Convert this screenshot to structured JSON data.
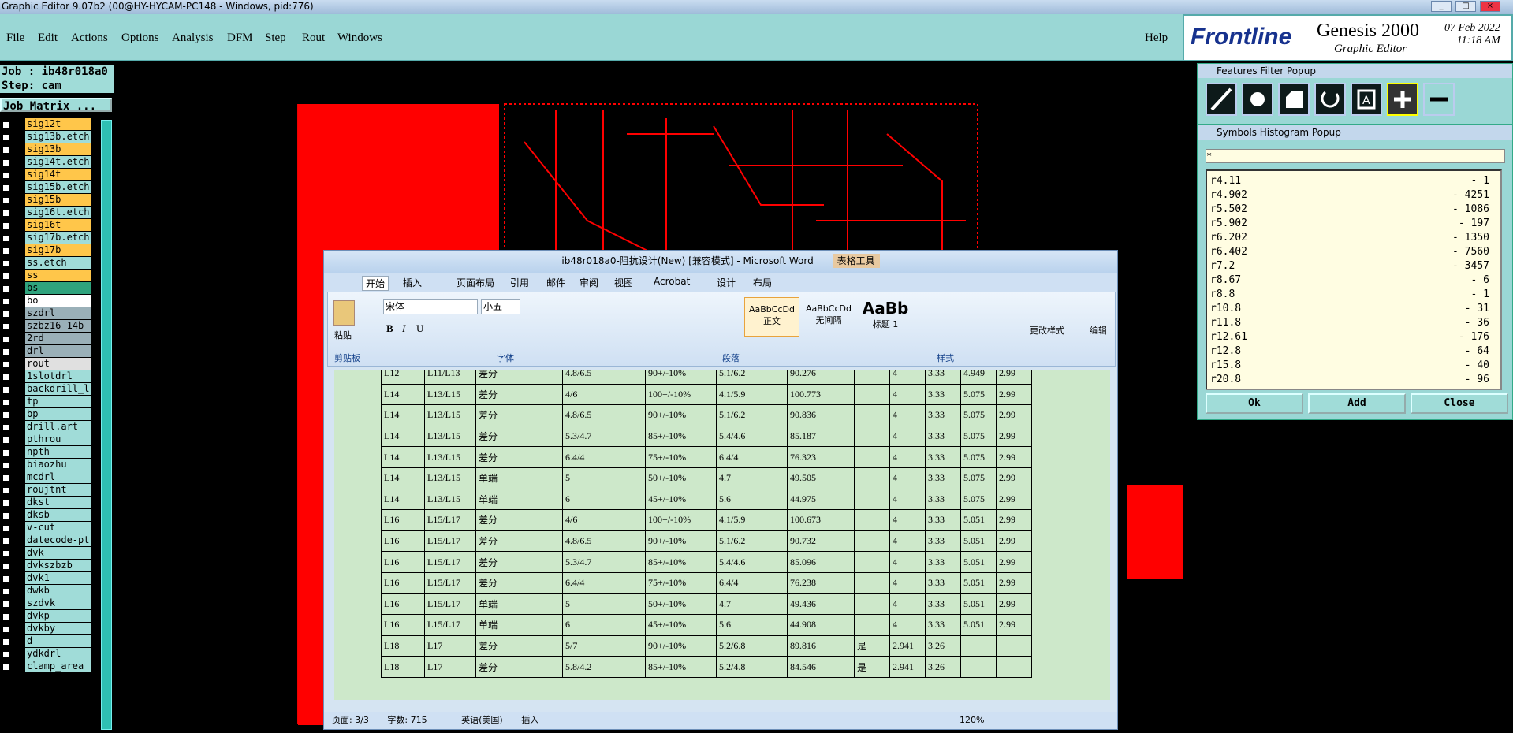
{
  "app": {
    "title": "Graphic Editor 9.07b2 (00@HY-HYCAM-PC148 - Windows, pid:776)"
  },
  "menu": [
    "File",
    "Edit",
    "Actions",
    "Options",
    "Analysis",
    "DFM",
    "Step",
    "Rout",
    "Windows"
  ],
  "help": "Help",
  "logo": {
    "brand": "Frontline",
    "product": "Genesis 2000",
    "sub": "Graphic Editor",
    "date": "07 Feb 2022",
    "time": "11:18 AM"
  },
  "job": {
    "job": "Job : ib48r018a0",
    "step": "Step: cam",
    "matrix": "Job Matrix ..."
  },
  "layers": [
    {
      "name": "sig12t",
      "color": "#ffc64a"
    },
    {
      "name": "sig13b.etch",
      "color": "#a0dcd8"
    },
    {
      "name": "sig13b",
      "color": "#ffc64a"
    },
    {
      "name": "sig14t.etch",
      "color": "#a0dcd8"
    },
    {
      "name": "sig14t",
      "color": "#ffc64a"
    },
    {
      "name": "sig15b.etch",
      "color": "#a0dcd8"
    },
    {
      "name": "sig15b",
      "color": "#ffc64a"
    },
    {
      "name": "sig16t.etch",
      "color": "#a0dcd8"
    },
    {
      "name": "sig16t",
      "color": "#ffc64a"
    },
    {
      "name": "sig17b.etch",
      "color": "#a0dcd8"
    },
    {
      "name": "sig17b",
      "color": "#ffc64a"
    },
    {
      "name": "ss.etch",
      "color": "#a0dcd8"
    },
    {
      "name": "ss",
      "color": "#ffc64a"
    },
    {
      "name": "bs",
      "color": "#2fa37d"
    },
    {
      "name": "bo",
      "color": "#ffffff"
    },
    {
      "name": "szdrl",
      "color": "#9ab0b8"
    },
    {
      "name": "szbz16-14b",
      "color": "#9ab0b8"
    },
    {
      "name": "2rd",
      "color": "#9ab0b8"
    },
    {
      "name": "drl",
      "color": "#9ab0b8"
    },
    {
      "name": "rout",
      "color": "#e0e0e0"
    },
    {
      "name": "1slotdrl",
      "color": "#a0dcd8"
    },
    {
      "name": "backdrill_l",
      "color": "#a0dcd8"
    },
    {
      "name": "tp",
      "color": "#a0dcd8"
    },
    {
      "name": "bp",
      "color": "#a0dcd8"
    },
    {
      "name": "drill.art",
      "color": "#a0dcd8"
    },
    {
      "name": "pthrou",
      "color": "#a0dcd8"
    },
    {
      "name": "npth",
      "color": "#a0dcd8"
    },
    {
      "name": "biaozhu",
      "color": "#a0dcd8"
    },
    {
      "name": "mcdrl",
      "color": "#a0dcd8"
    },
    {
      "name": "roujtnt",
      "color": "#a0dcd8"
    },
    {
      "name": "dkst",
      "color": "#a0dcd8"
    },
    {
      "name": "dksb",
      "color": "#a0dcd8"
    },
    {
      "name": "v-cut",
      "color": "#a0dcd8"
    },
    {
      "name": "datecode-pt",
      "color": "#a0dcd8"
    },
    {
      "name": "dvk",
      "color": "#a0dcd8"
    },
    {
      "name": "dvkszbzb",
      "color": "#a0dcd8"
    },
    {
      "name": "dvk1",
      "color": "#a0dcd8"
    },
    {
      "name": "dwkb",
      "color": "#a0dcd8"
    },
    {
      "name": "szdvk",
      "color": "#a0dcd8"
    },
    {
      "name": "dvkp",
      "color": "#a0dcd8"
    },
    {
      "name": "dvkby",
      "color": "#a0dcd8"
    },
    {
      "name": "d",
      "color": "#a0dcd8"
    },
    {
      "name": "ydkdrl",
      "color": "#a0dcd8"
    },
    {
      "name": "clamp_area",
      "color": "#a0dcd8"
    }
  ],
  "filter_popup": {
    "title": "Features Filter Popup"
  },
  "hist_popup": {
    "title": "Symbols Histogram Popup",
    "filter": "*",
    "rows": [
      [
        "r4.11",
        "- 1"
      ],
      [
        "r4.902",
        "- 4251"
      ],
      [
        "r5.502",
        "- 1086"
      ],
      [
        "r5.902",
        "- 197"
      ],
      [
        "r6.202",
        "- 1350"
      ],
      [
        "r6.402",
        "- 7560"
      ],
      [
        "r7.2",
        "- 3457"
      ],
      [
        "r8.67",
        "- 6"
      ],
      [
        "r8.8",
        "- 1"
      ],
      [
        "r10.8",
        "- 31"
      ],
      [
        "r11.8",
        "- 36"
      ],
      [
        "r12.61",
        "- 176"
      ],
      [
        "r12.8",
        "- 64"
      ],
      [
        "r15.8",
        "- 40"
      ],
      [
        "r20.8",
        "- 96"
      ]
    ],
    "ok": "Ok",
    "add": "Add",
    "close": "Close"
  },
  "word": {
    "title": "ib48r018a0-阻抗设计(New) [兼容模式] - Microsoft Word",
    "tools": "表格工具",
    "tabs": [
      "开始",
      "插入",
      "页面布局",
      "引用",
      "邮件",
      "审阅",
      "视图",
      "Acrobat",
      "设计",
      "布局"
    ],
    "font": "宋体",
    "size": "小五",
    "paste": "粘贴",
    "clipboard": "剪贴板",
    "font_grp": "字体",
    "para_grp": "段落",
    "style_grp": "样式",
    "styles": [
      "正文",
      "无间隔",
      "标题 1"
    ],
    "change_style": "更改样式",
    "edit": "编辑",
    "rows": [
      [
        "L12",
        "L11/L13",
        "差分",
        "4.8/6.5",
        "90+/-10%",
        "5.1/6.2",
        "90.276",
        "",
        "4",
        "3.33",
        "4.949",
        "2.99"
      ],
      [
        "L14",
        "L13/L15",
        "差分",
        "4/6",
        "100+/-10%",
        "4.1/5.9",
        "100.773",
        "",
        "4",
        "3.33",
        "5.075",
        "2.99"
      ],
      [
        "L14",
        "L13/L15",
        "差分",
        "4.8/6.5",
        "90+/-10%",
        "5.1/6.2",
        "90.836",
        "",
        "4",
        "3.33",
        "5.075",
        "2.99"
      ],
      [
        "L14",
        "L13/L15",
        "差分",
        "5.3/4.7",
        "85+/-10%",
        "5.4/4.6",
        "85.187",
        "",
        "4",
        "3.33",
        "5.075",
        "2.99"
      ],
      [
        "L14",
        "L13/L15",
        "差分",
        "6.4/4",
        "75+/-10%",
        "6.4/4",
        "76.323",
        "",
        "4",
        "3.33",
        "5.075",
        "2.99"
      ],
      [
        "L14",
        "L13/L15",
        "单端",
        "5",
        "50+/-10%",
        "4.7",
        "49.505",
        "",
        "4",
        "3.33",
        "5.075",
        "2.99"
      ],
      [
        "L14",
        "L13/L15",
        "单端",
        "6",
        "45+/-10%",
        "5.6",
        "44.975",
        "",
        "4",
        "3.33",
        "5.075",
        "2.99"
      ],
      [
        "L16",
        "L15/L17",
        "差分",
        "4/6",
        "100+/-10%",
        "4.1/5.9",
        "100.673",
        "",
        "4",
        "3.33",
        "5.051",
        "2.99"
      ],
      [
        "L16",
        "L15/L17",
        "差分",
        "4.8/6.5",
        "90+/-10%",
        "5.1/6.2",
        "90.732",
        "",
        "4",
        "3.33",
        "5.051",
        "2.99"
      ],
      [
        "L16",
        "L15/L17",
        "差分",
        "5.3/4.7",
        "85+/-10%",
        "5.4/4.6",
        "85.096",
        "",
        "4",
        "3.33",
        "5.051",
        "2.99"
      ],
      [
        "L16",
        "L15/L17",
        "差分",
        "6.4/4",
        "75+/-10%",
        "6.4/4",
        "76.238",
        "",
        "4",
        "3.33",
        "5.051",
        "2.99"
      ],
      [
        "L16",
        "L15/L17",
        "单端",
        "5",
        "50+/-10%",
        "4.7",
        "49.436",
        "",
        "4",
        "3.33",
        "5.051",
        "2.99"
      ],
      [
        "L16",
        "L15/L17",
        "单端",
        "6",
        "45+/-10%",
        "5.6",
        "44.908",
        "",
        "4",
        "3.33",
        "5.051",
        "2.99"
      ],
      [
        "L18",
        "L17",
        "差分",
        "5/7",
        "90+/-10%",
        "5.2/6.8",
        "89.816",
        "是",
        "2.941",
        "3.26",
        "",
        ""
      ],
      [
        "L18",
        "L17",
        "差分",
        "5.8/4.2",
        "85+/-10%",
        "5.2/4.8",
        "84.546",
        "是",
        "2.941",
        "3.26",
        "",
        ""
      ]
    ],
    "status": {
      "page": "页面: 3/3",
      "words": "字数: 715",
      "lang": "英语(美国)",
      "mode": "插入",
      "zoom": "120%"
    }
  }
}
